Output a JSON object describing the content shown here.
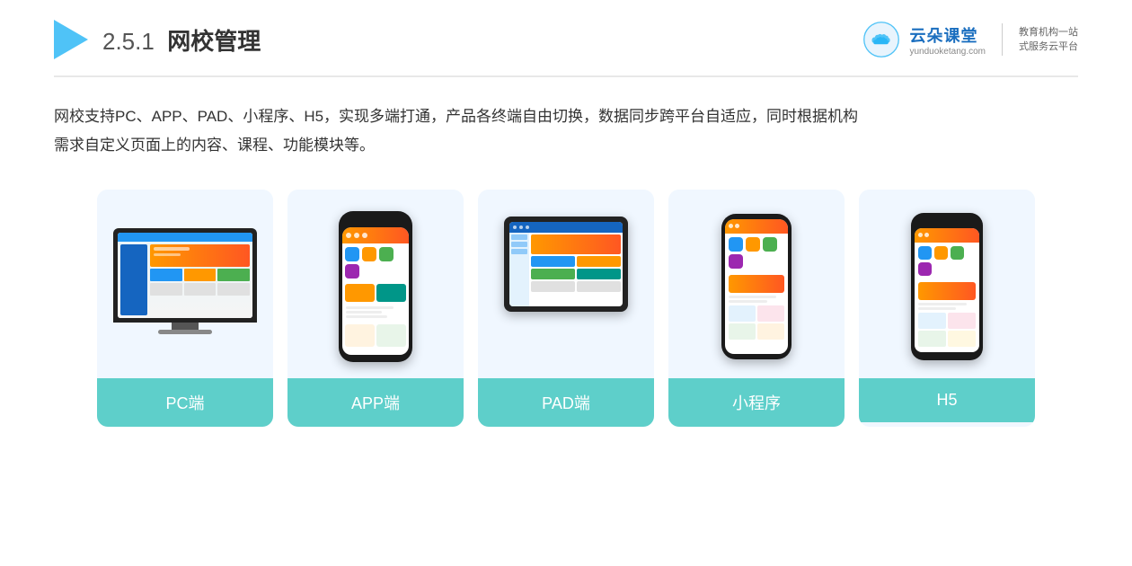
{
  "header": {
    "section_number": "2.5.1",
    "title": "网校管理",
    "logo_name": "云朵课堂",
    "logo_url": "yunduoketang.com",
    "logo_slogan_line1": "教育机构一站",
    "logo_slogan_line2": "式服务云平台"
  },
  "description": {
    "text_line1": "网校支持PC、APP、PAD、小程序、H5，实现多端打通，产品各终端自由切换，数据同步跨平台自适应，同时根据机构",
    "text_line2": "需求自定义页面上的内容、课程、功能模块等。"
  },
  "cards": [
    {
      "id": "pc",
      "label": "PC端"
    },
    {
      "id": "app",
      "label": "APP端"
    },
    {
      "id": "pad",
      "label": "PAD端"
    },
    {
      "id": "miniprogram",
      "label": "小程序"
    },
    {
      "id": "h5",
      "label": "H5"
    }
  ]
}
